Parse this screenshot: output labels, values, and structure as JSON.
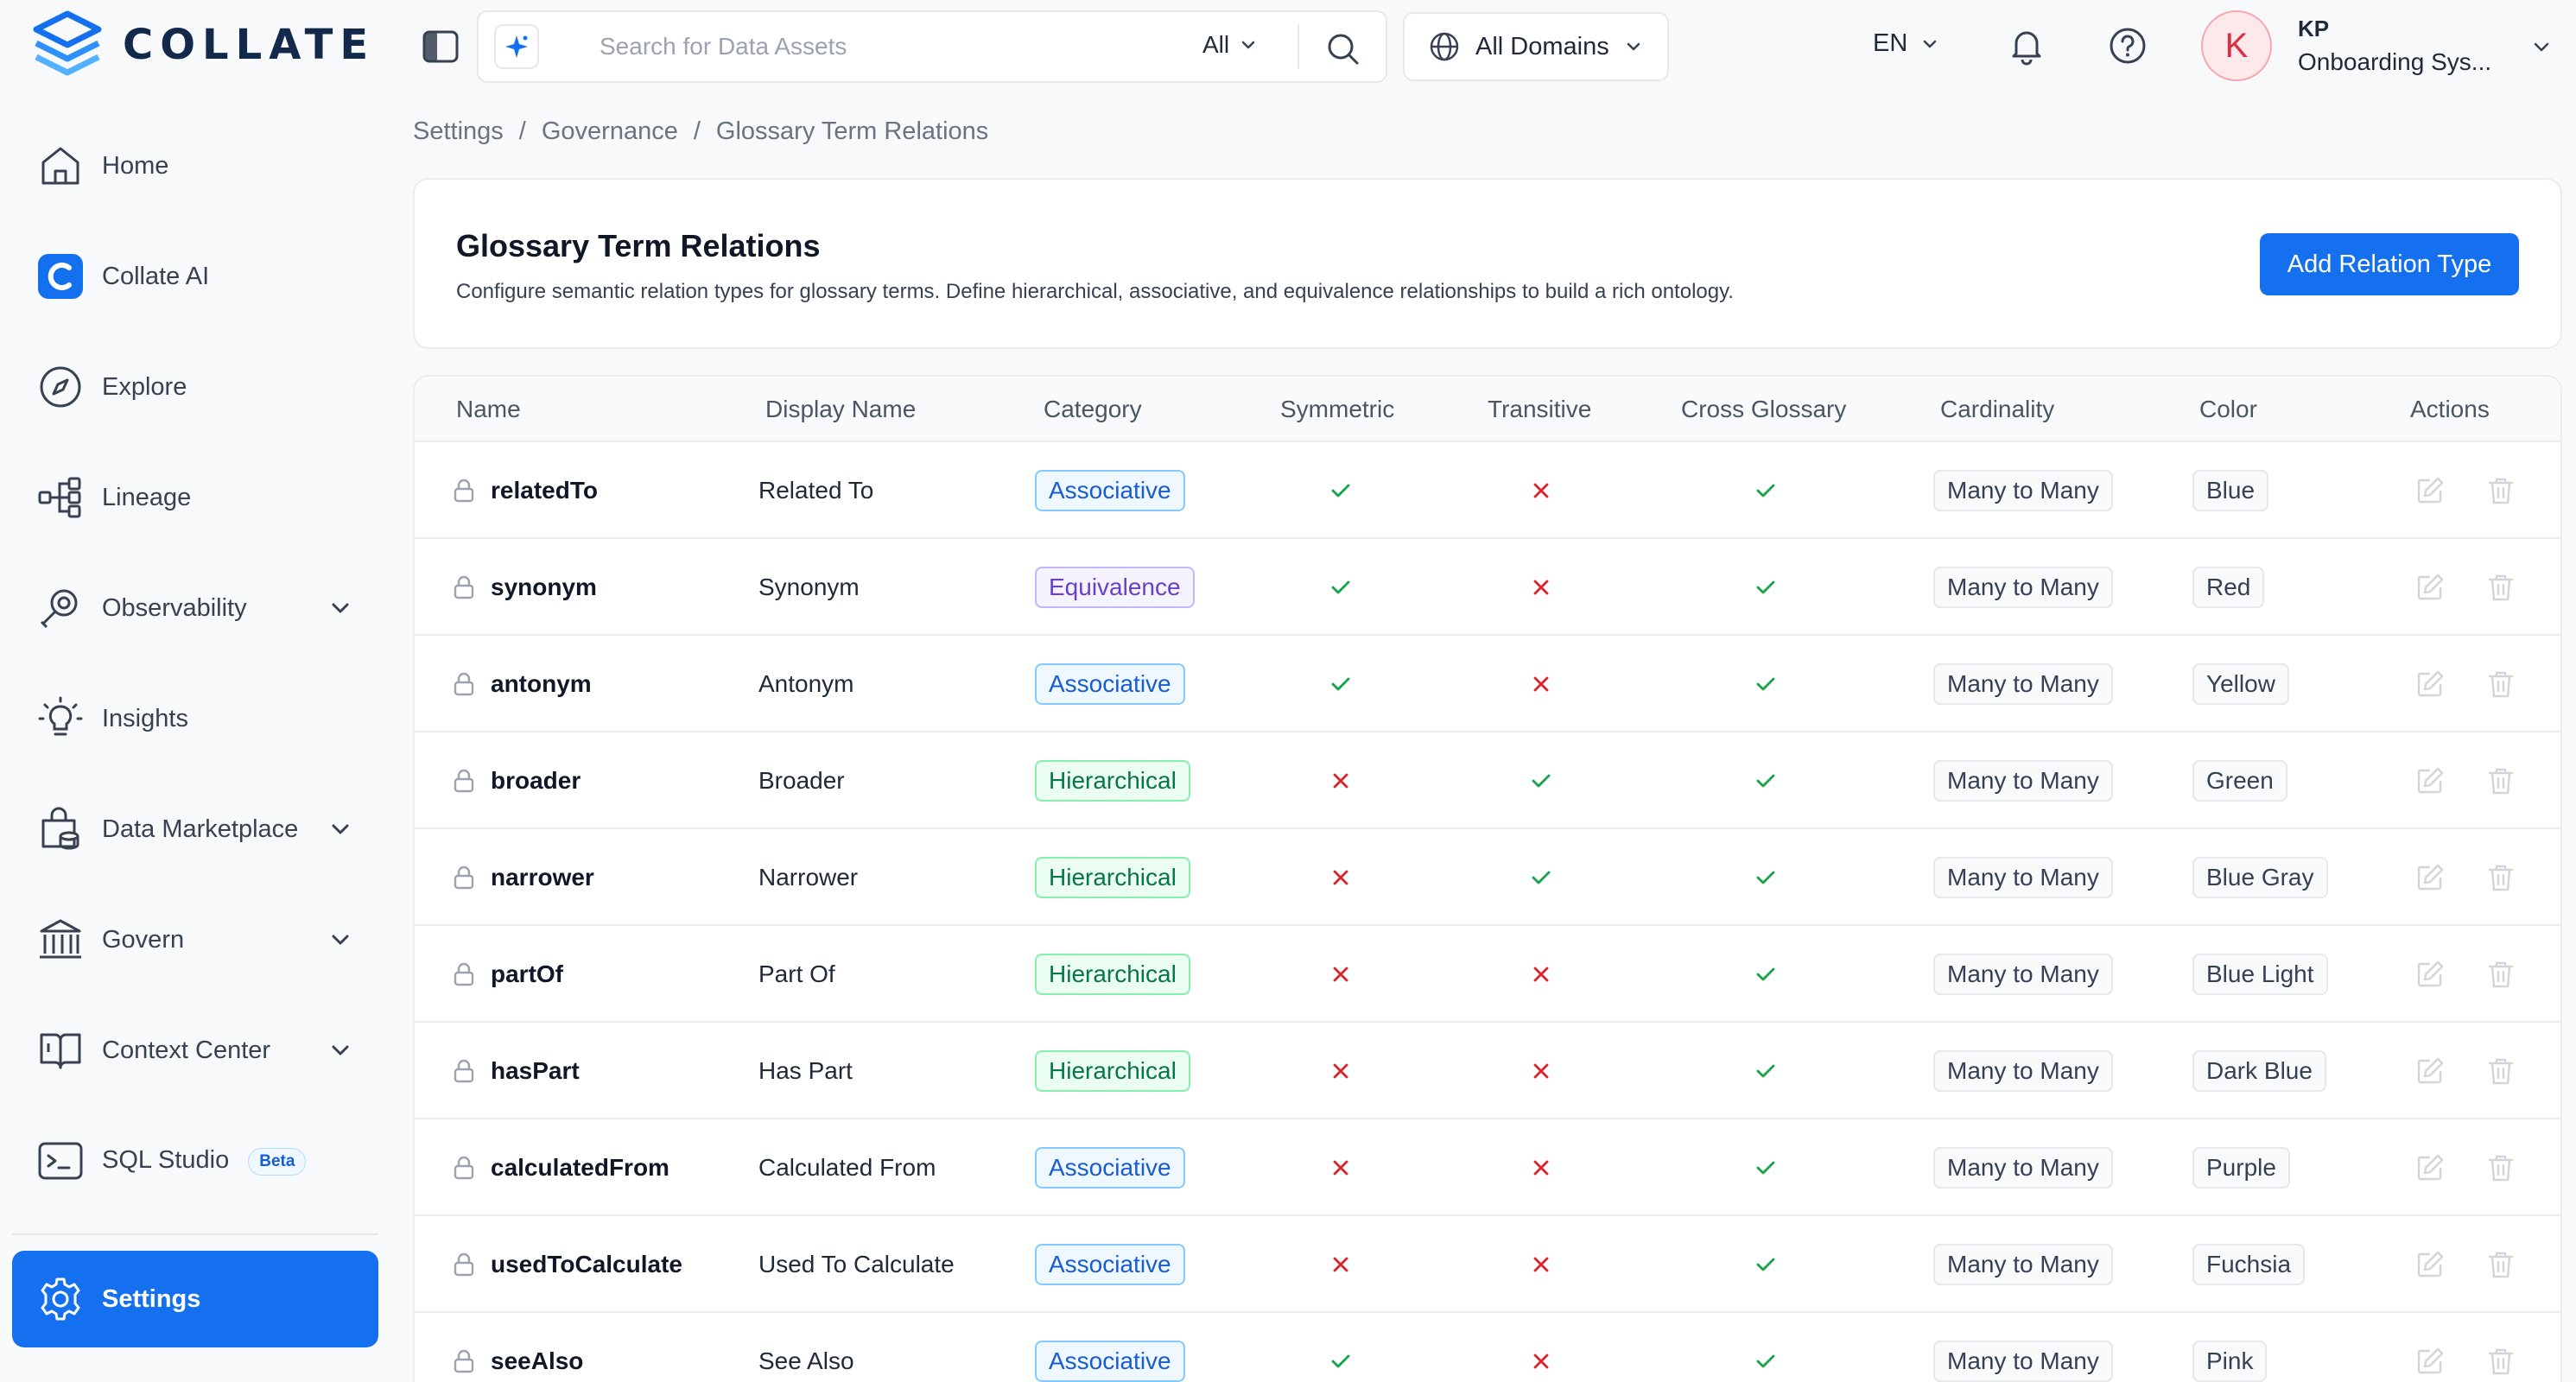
{
  "app": {
    "brand": "COLLATE"
  },
  "sidebar": {
    "items": [
      {
        "label": "Home",
        "icon": "home-icon"
      },
      {
        "label": "Collate AI",
        "icon": "collate-ai-icon"
      },
      {
        "label": "Explore",
        "icon": "compass-icon"
      },
      {
        "label": "Lineage",
        "icon": "lineage-icon"
      },
      {
        "label": "Observability",
        "icon": "observability-icon",
        "expandable": true
      },
      {
        "label": "Insights",
        "icon": "lightbulb-icon"
      },
      {
        "label": "Data Marketplace",
        "icon": "marketplace-icon",
        "expandable": true
      },
      {
        "label": "Govern",
        "icon": "govern-icon",
        "expandable": true
      },
      {
        "label": "Context Center",
        "icon": "book-icon",
        "expandable": true
      },
      {
        "label": "SQL Studio",
        "icon": "terminal-icon",
        "badge": "Beta"
      }
    ],
    "settings": {
      "label": "Settings",
      "icon": "gear-icon",
      "active": true
    }
  },
  "topbar": {
    "search_placeholder": "Search for Data Assets",
    "search_scope": "All",
    "domains": "All Domains",
    "language": "EN",
    "user": {
      "avatar_letter": "K",
      "initials": "KP",
      "name": "Onboarding Sys..."
    }
  },
  "breadcrumb": [
    "Settings",
    "Governance",
    "Glossary Term Relations"
  ],
  "header": {
    "title": "Glossary Term Relations",
    "description": "Configure semantic relation types for glossary terms. Define hierarchical, associative, and equivalence relationships to build a rich ontology.",
    "add_button": "Add Relation Type"
  },
  "table": {
    "columns": [
      "Name",
      "Display Name",
      "Category",
      "Symmetric",
      "Transitive",
      "Cross Glossary",
      "Cardinality",
      "Color",
      "Actions"
    ],
    "rows": [
      {
        "name": "relatedTo",
        "display": "Related To",
        "category": "Associative",
        "symmetric": true,
        "transitive": false,
        "cross": true,
        "cardinality": "Many to Many",
        "color": "Blue"
      },
      {
        "name": "synonym",
        "display": "Synonym",
        "category": "Equivalence",
        "symmetric": true,
        "transitive": false,
        "cross": true,
        "cardinality": "Many to Many",
        "color": "Red"
      },
      {
        "name": "antonym",
        "display": "Antonym",
        "category": "Associative",
        "symmetric": true,
        "transitive": false,
        "cross": true,
        "cardinality": "Many to Many",
        "color": "Yellow"
      },
      {
        "name": "broader",
        "display": "Broader",
        "category": "Hierarchical",
        "symmetric": false,
        "transitive": true,
        "cross": true,
        "cardinality": "Many to Many",
        "color": "Green"
      },
      {
        "name": "narrower",
        "display": "Narrower",
        "category": "Hierarchical",
        "symmetric": false,
        "transitive": true,
        "cross": true,
        "cardinality": "Many to Many",
        "color": "Blue Gray"
      },
      {
        "name": "partOf",
        "display": "Part Of",
        "category": "Hierarchical",
        "symmetric": false,
        "transitive": false,
        "cross": true,
        "cardinality": "Many to Many",
        "color": "Blue Light"
      },
      {
        "name": "hasPart",
        "display": "Has Part",
        "category": "Hierarchical",
        "symmetric": false,
        "transitive": false,
        "cross": true,
        "cardinality": "Many to Many",
        "color": "Dark Blue"
      },
      {
        "name": "calculatedFrom",
        "display": "Calculated From",
        "category": "Associative",
        "symmetric": false,
        "transitive": false,
        "cross": true,
        "cardinality": "Many to Many",
        "color": "Purple"
      },
      {
        "name": "usedToCalculate",
        "display": "Used To Calculate",
        "category": "Associative",
        "symmetric": false,
        "transitive": false,
        "cross": true,
        "cardinality": "Many to Many",
        "color": "Fuchsia"
      },
      {
        "name": "seeAlso",
        "display": "See Also",
        "category": "Associative",
        "symmetric": true,
        "transitive": false,
        "cross": true,
        "cardinality": "Many to Many",
        "color": "Pink"
      }
    ]
  },
  "colors": {
    "accent": "#1570ef",
    "check": "#16a34a",
    "cross": "#dc2626"
  }
}
